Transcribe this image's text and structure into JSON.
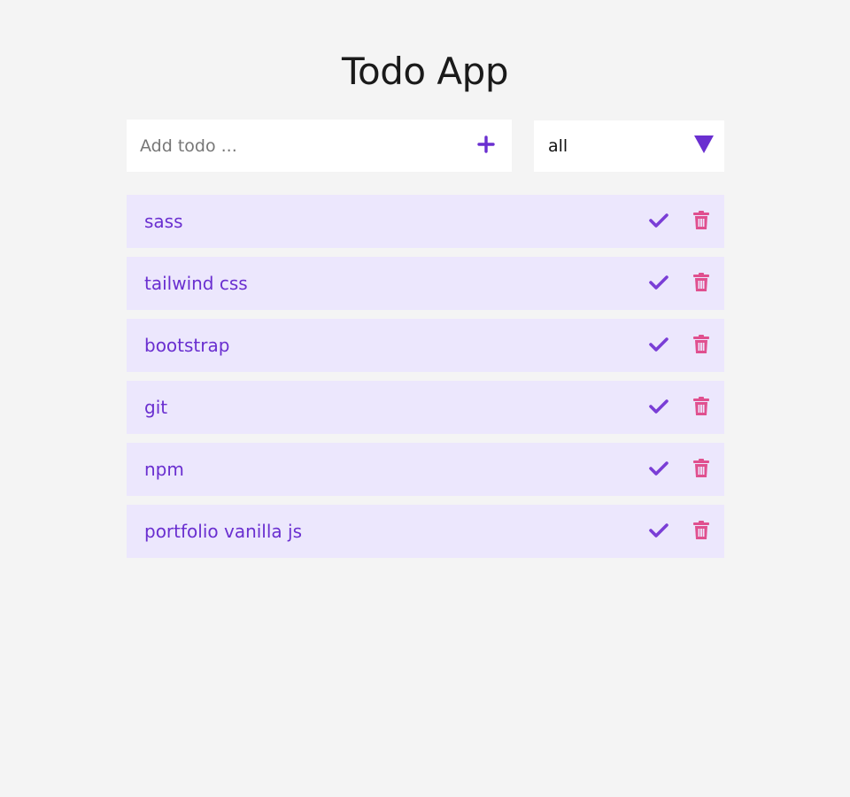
{
  "app": {
    "title": "Todo App"
  },
  "add_form": {
    "placeholder": "Add todo ...",
    "add_icon": "plus-icon"
  },
  "filter": {
    "selected": "all",
    "icon": "triangle-down-icon"
  },
  "todos": [
    {
      "text": "sass"
    },
    {
      "text": "tailwind css"
    },
    {
      "text": "bootstrap"
    },
    {
      "text": "git"
    },
    {
      "text": "npm"
    },
    {
      "text": "portfolio vanilla js"
    }
  ],
  "item_actions": {
    "complete_icon": "check-icon",
    "delete_icon": "trash-icon"
  },
  "colors": {
    "background": "#f4f4f4",
    "accent": "#6a2fd0",
    "item_background": "#ece7fd",
    "delete": "#e0508f",
    "check": "#7a3ed6"
  }
}
